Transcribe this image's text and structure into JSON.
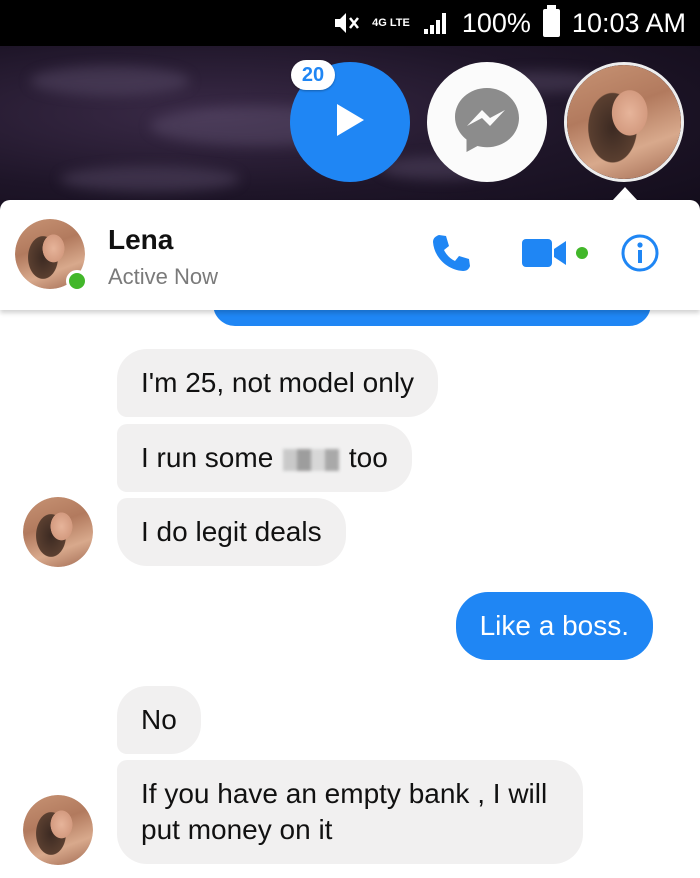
{
  "status_bar": {
    "network": "4G LTE",
    "battery": "100%",
    "time": "10:03 AM",
    "icons": [
      "mute-icon",
      "network-icon",
      "signal-icon",
      "battery-icon"
    ]
  },
  "chat_heads": {
    "badge_count": "20",
    "icons": [
      "play-icon",
      "messenger-icon"
    ]
  },
  "header": {
    "name": "Lena",
    "status": "Active Now",
    "actions": [
      "phone-icon",
      "video-camera-icon",
      "info-icon"
    ]
  },
  "messages": [
    {
      "direction": "in",
      "text": "I'm 25, not model only"
    },
    {
      "direction": "in",
      "text_before": "I run some",
      "text_after": "too"
    },
    {
      "direction": "in",
      "text": "I do legit deals"
    },
    {
      "direction": "out",
      "text": "Like a boss."
    },
    {
      "direction": "in",
      "text": "No"
    },
    {
      "direction": "in",
      "text": "If you have an empty bank , I will put money on it"
    }
  ],
  "colors": {
    "accent": "#1f86f4",
    "incoming_bubble": "#f1f0f0",
    "online": "#42b72a"
  }
}
